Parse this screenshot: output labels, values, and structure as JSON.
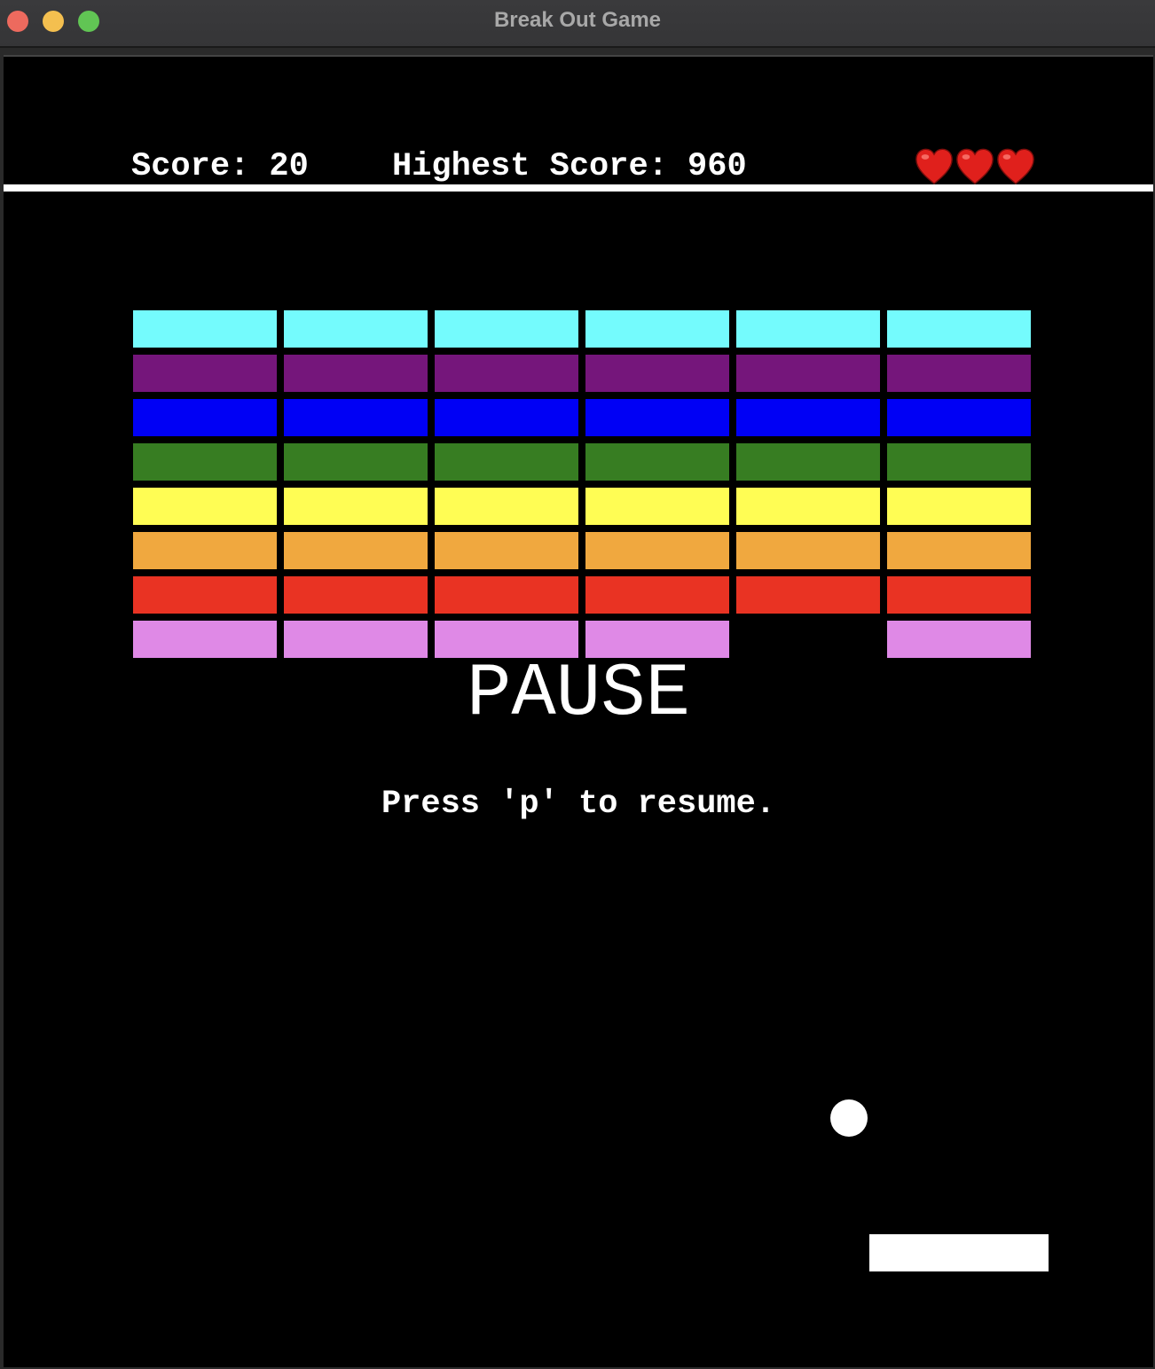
{
  "window": {
    "title": "Break Out Game"
  },
  "hud": {
    "score_text": "Score: 20",
    "highest_score_text": "Highest Score: 960",
    "lives": 3,
    "life_icon": "heart-icon",
    "life_color": "#e0201c"
  },
  "bricks": {
    "columns": 6,
    "rows": [
      {
        "color": "#74fbfd",
        "present": [
          true,
          true,
          true,
          true,
          true,
          true
        ]
      },
      {
        "color": "#75167b",
        "present": [
          true,
          true,
          true,
          true,
          true,
          true
        ]
      },
      {
        "color": "#0000f5",
        "present": [
          true,
          true,
          true,
          true,
          true,
          true
        ]
      },
      {
        "color": "#377d22",
        "present": [
          true,
          true,
          true,
          true,
          true,
          true
        ]
      },
      {
        "color": "#fffd54",
        "present": [
          true,
          true,
          true,
          true,
          true,
          true
        ]
      },
      {
        "color": "#f0a83f",
        "present": [
          true,
          true,
          true,
          true,
          true,
          true
        ]
      },
      {
        "color": "#e93323",
        "present": [
          true,
          true,
          true,
          true,
          true,
          true
        ]
      },
      {
        "color": "#df89e6",
        "present": [
          true,
          true,
          true,
          true,
          false,
          true
        ]
      }
    ]
  },
  "overlay": {
    "pause_text": "PAUSE",
    "resume_text": "Press 'p' to resume."
  },
  "colors": {
    "background": "#000000",
    "foreground": "#ffffff"
  }
}
